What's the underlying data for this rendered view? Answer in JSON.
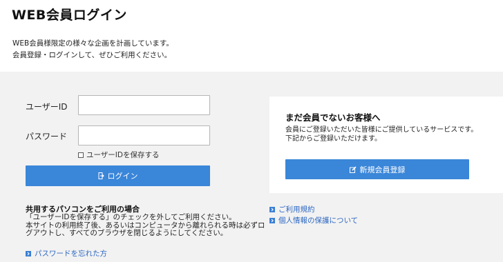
{
  "page": {
    "title": "WEB会員ログイン",
    "intro_lines": [
      "WEB会員様限定の様々な企画を計画しています。",
      "会員登録・ログインして、ぜひご利用ください。"
    ]
  },
  "login": {
    "user_id_label": "ユーザーID",
    "user_id_value": "",
    "password_label": "パスワード",
    "password_value": "",
    "remember_label": "ユーザーIDを保存する",
    "login_button": "ログイン"
  },
  "register": {
    "title": "まだ会員でないお客様へ",
    "desc_lines": [
      "会員にご登録いただいた皆様にご提供しているサービスです。",
      "下記からご登録いただけます。"
    ],
    "button": "新規会員登録"
  },
  "shared_pc": {
    "title": "共用するパソコンをご利用の場合",
    "lines": [
      "「ユーザーIDを保存する」のチェックを外してご利用ください。",
      "本サイトの利用終了後、あるいはコンピュータから離れられる時は必ずロ",
      "グアウトし、すべてのブラウザを閉じるようにしてください。"
    ]
  },
  "links": {
    "forgot_password": "パスワードを忘れた方",
    "terms": "ご利用規約",
    "privacy": "個人情報の保護について"
  },
  "colors": {
    "accent": "#3a86d9",
    "link": "#2c67c2",
    "background": "#f2f2f2"
  },
  "icons": {
    "login": "login-door-icon",
    "register": "pencil-edit-icon",
    "link_arrow": "chevron-right-icon"
  }
}
